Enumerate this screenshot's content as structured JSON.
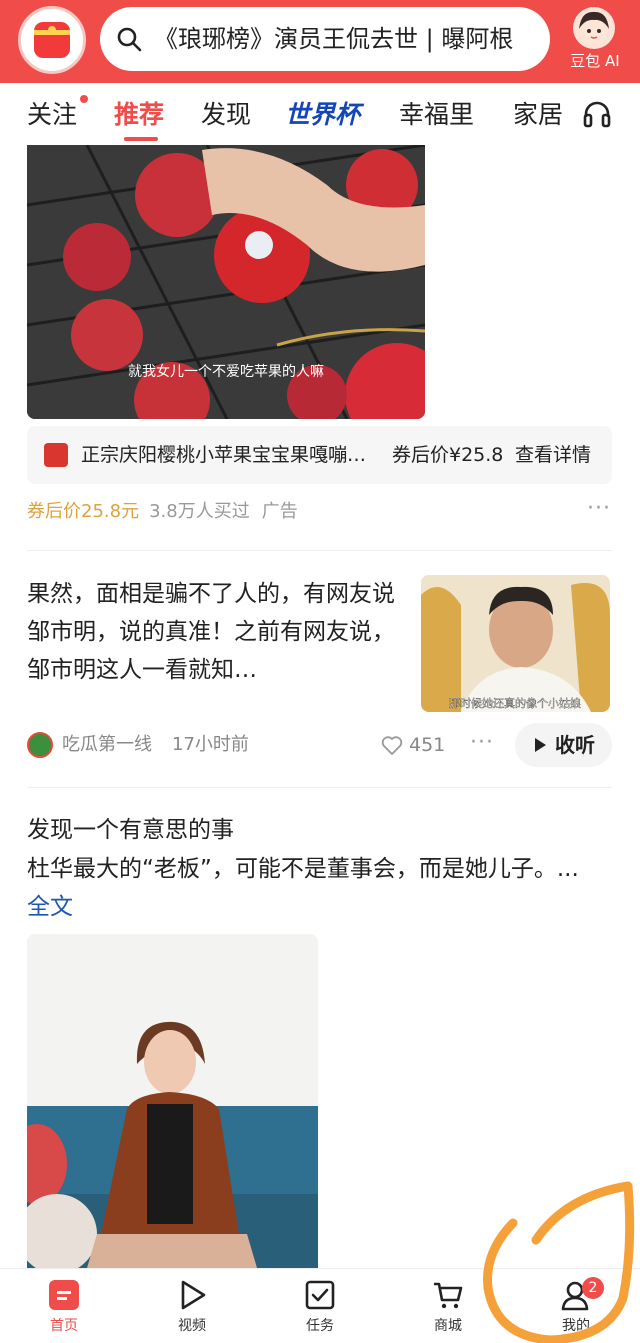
{
  "header": {
    "search_text": "《琅琊榜》演员王侃去世 | 曝阿根",
    "ai_label": "豆包 AI"
  },
  "tabs": [
    {
      "label": "关注"
    },
    {
      "label": "推荐"
    },
    {
      "label": "发现"
    },
    {
      "label": "世界杯"
    },
    {
      "label": "幸福里"
    },
    {
      "label": "家居"
    }
  ],
  "ad": {
    "image_caption": "就我女儿一个不爱吃苹果的人嘛",
    "product_name": "正宗庆阳樱桃小苹果宝宝果嘎嘣…",
    "product_price": "券后价¥25.8",
    "product_detail": "查看详情",
    "price": "券后价25.8元",
    "bought": "3.8万人买过",
    "tag": "广告"
  },
  "article1": {
    "title": "果然，面相是骗不了人的，有网友说邹市明，说的真准！之前有网友说，邹市明这人一看就知…",
    "thumb_caption": "那时候她还真的像个小姑娘",
    "source": "吃瓜第一线",
    "time": "17小时前",
    "likes": "451",
    "listen_label": "收听"
  },
  "article2": {
    "line1": "发现一个有意思的事",
    "text": "杜华最大的“老板”，可能不是董事会，而是她儿子。...",
    "fulltext": "全文"
  },
  "bottom_nav": [
    {
      "label": "首页",
      "icon": "home-icon"
    },
    {
      "label": "视频",
      "icon": "video-play-icon"
    },
    {
      "label": "任务",
      "icon": "task-check-icon"
    },
    {
      "label": "商城",
      "icon": "cart-icon"
    },
    {
      "label": "我的",
      "icon": "profile-icon",
      "badge": "2"
    }
  ],
  "colors": {
    "brand_red": "#f04d4a",
    "world_cup_blue": "#1546b8",
    "link_blue": "#1d57b4",
    "ad_price_orange": "#e0a13c",
    "annotation_orange": "#f5a13a"
  }
}
